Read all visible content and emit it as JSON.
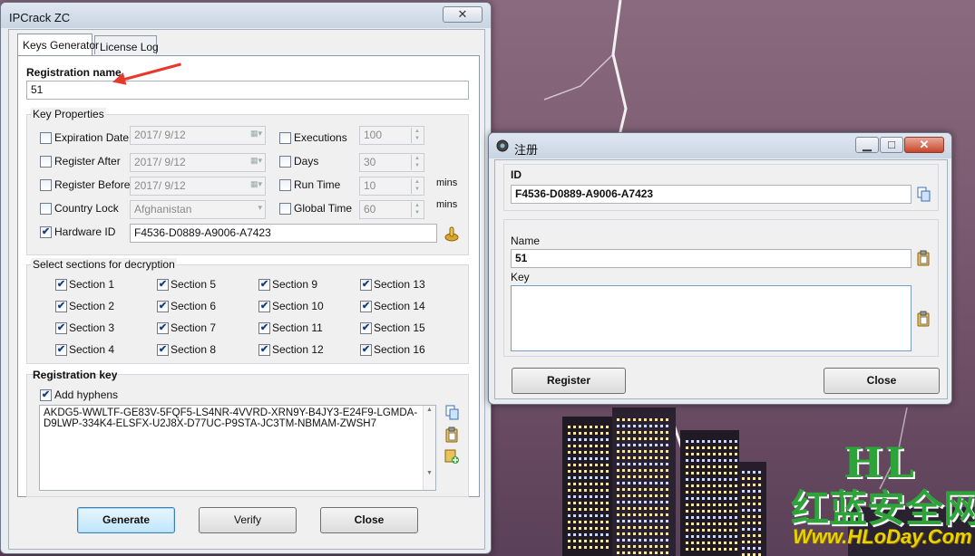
{
  "colors": {
    "accent": "#3c7fb1",
    "arrow": "#e8382c",
    "watermark_green": "#2ea33a",
    "watermark_yellow": "#e8d200"
  },
  "keygen": {
    "title": "IPCrack ZC",
    "close_glyph": "✕",
    "tabs": [
      "Keys Generator",
      "License Log"
    ],
    "registration_name_label": "Registration name",
    "registration_name_value": "51",
    "key_properties_title": "Key Properties",
    "props": {
      "expiration_date": {
        "label": "Expiration Date",
        "value": "2017/  9/12",
        "checked": false
      },
      "register_after": {
        "label": "Register After",
        "value": "2017/  9/12",
        "checked": false
      },
      "register_before": {
        "label": "Register Before",
        "value": "2017/  9/12",
        "checked": false
      },
      "country_lock": {
        "label": "Country Lock",
        "value": "Afghanistan",
        "checked": false
      },
      "hardware_id": {
        "label": "Hardware ID",
        "value": "F4536-D0889-A9006-A7423",
        "checked": true
      },
      "executions": {
        "label": "Executions",
        "value": "100",
        "checked": false
      },
      "days": {
        "label": "Days",
        "value": "30",
        "checked": false
      },
      "run_time": {
        "label": "Run Time",
        "value": "10",
        "unit": "mins",
        "checked": false
      },
      "global_time": {
        "label": "Global Time",
        "value": "60",
        "unit": "mins",
        "checked": false
      }
    },
    "sections_title": "Select sections for decryption",
    "sections": [
      "Section 1",
      "Section 5",
      "Section 9",
      "Section 13",
      "Section 2",
      "Section 6",
      "Section 10",
      "Section 14",
      "Section 3",
      "Section 7",
      "Section 11",
      "Section 15",
      "Section 4",
      "Section 8",
      "Section 12",
      "Section 16"
    ],
    "registration_key_label": "Registration key",
    "add_hyphens_label": "Add hyphens",
    "add_hyphens_checked": true,
    "key_text": "AKDG5-WWLTF-GE83V-5FQF5-LS4NR-4VVRD-XRN9Y-B4JY3-E24F9-LGMDA-D9LWP-334K4-ELSFX-U2J8X-D77UC-P9STA-JC3TM-NBMAM-ZWSH7",
    "buttons": {
      "generate": "Generate",
      "verify": "Verify",
      "close": "Close"
    }
  },
  "register_dialog": {
    "title": "注册",
    "id_label": "ID",
    "id_value": "F4536-D0889-A9006-A7423",
    "name_label": "Name",
    "name_value": "51",
    "key_label": "Key",
    "key_value": "",
    "buttons": {
      "register": "Register",
      "close": "Close"
    },
    "window_controls": {
      "minimize": "▁",
      "maximize": "□",
      "close": "✕"
    }
  },
  "watermark": {
    "line1": "HL",
    "line2": "红蓝安全网",
    "line3": "Www.HLoDay.Com"
  }
}
